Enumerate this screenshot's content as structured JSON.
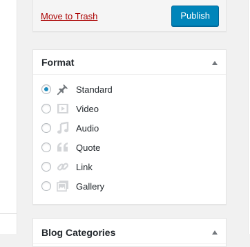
{
  "publish": {
    "trash_label": "Move to Trash",
    "publish_label": "Publish"
  },
  "format_box": {
    "title": "Format",
    "selected": "Standard",
    "options": [
      {
        "label": "Standard",
        "icon": "pin-icon",
        "checked": true
      },
      {
        "label": "Video",
        "icon": "video-icon",
        "checked": false
      },
      {
        "label": "Audio",
        "icon": "audio-icon",
        "checked": false
      },
      {
        "label": "Quote",
        "icon": "quote-icon",
        "checked": false
      },
      {
        "label": "Link",
        "icon": "link-icon",
        "checked": false
      },
      {
        "label": "Gallery",
        "icon": "gallery-icon",
        "checked": false
      }
    ]
  },
  "categories_box": {
    "title": "Blog Categories"
  },
  "colors": {
    "accent": "#0085ba",
    "trash": "#aa0000",
    "radio_checked": "#1e8cbe",
    "icon_gray": "#d3d5d8",
    "icon_dark": "#72777c"
  }
}
